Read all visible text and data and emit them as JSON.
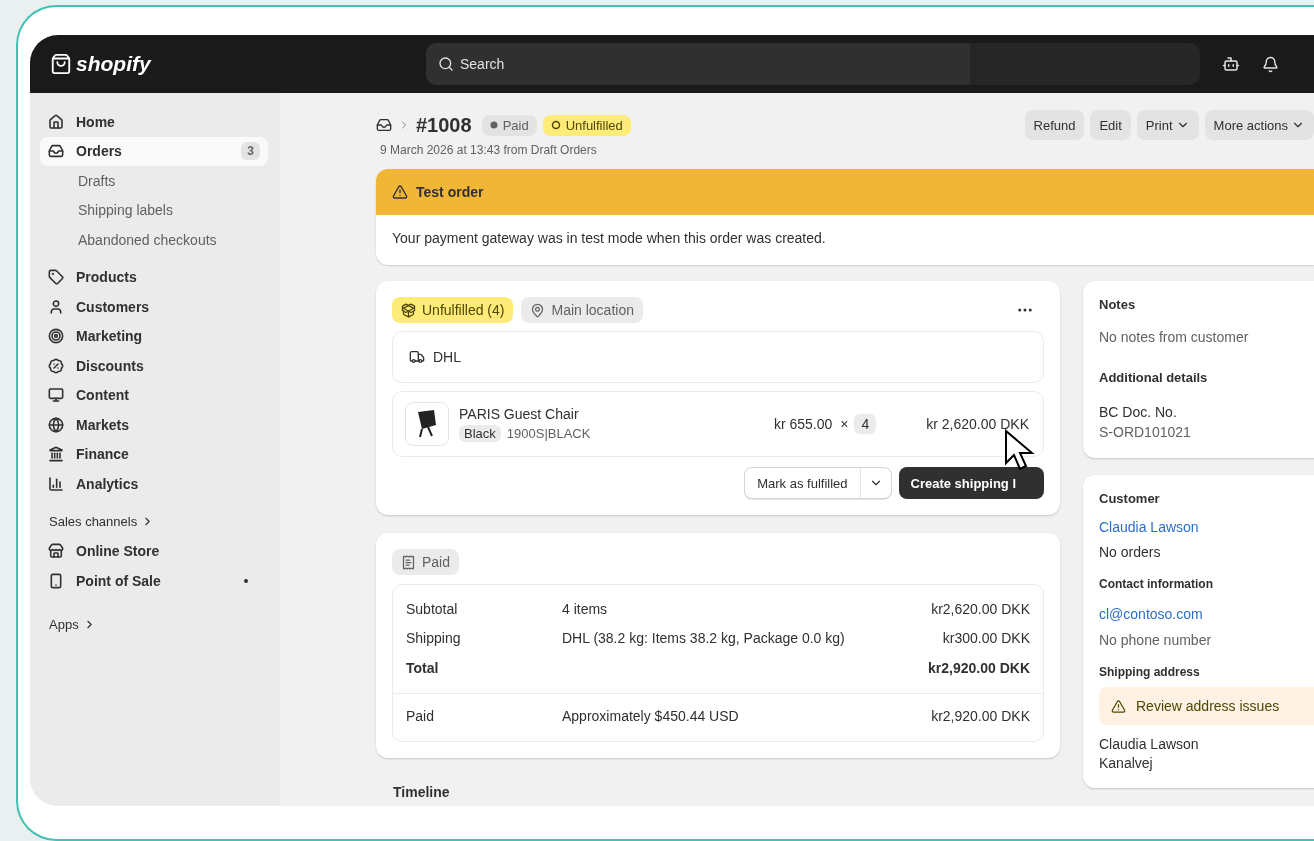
{
  "topbar": {
    "logo": "shopify",
    "search": {
      "placeholder": "Search"
    }
  },
  "sidebar": {
    "items": [
      {
        "kind": "nav",
        "label": "Home",
        "selected": false
      },
      {
        "kind": "nav",
        "label": "Orders",
        "selected": true,
        "badge": "3"
      },
      {
        "kind": "sub",
        "label": "Drafts",
        "selected": false
      },
      {
        "kind": "sub",
        "label": "Shipping labels",
        "selected": false
      },
      {
        "kind": "sub",
        "label": "Abandoned checkouts",
        "selected": false
      },
      {
        "kind": "nav",
        "label": "Products",
        "selected": false
      },
      {
        "kind": "nav",
        "label": "Customers",
        "selected": false
      },
      {
        "kind": "nav",
        "label": "Marketing",
        "selected": false
      },
      {
        "kind": "nav",
        "label": "Discounts",
        "selected": false
      },
      {
        "kind": "nav",
        "label": "Content",
        "selected": false
      },
      {
        "kind": "nav",
        "label": "Markets",
        "selected": false
      },
      {
        "kind": "nav",
        "label": "Finance",
        "selected": false
      },
      {
        "kind": "nav",
        "label": "Analytics",
        "selected": false
      },
      {
        "kind": "section",
        "label": "Sales channels"
      },
      {
        "kind": "nav",
        "label": "Online Store",
        "selected": false
      },
      {
        "kind": "nav",
        "label": "Point of Sale",
        "selected": false,
        "pinned": true
      },
      {
        "kind": "section",
        "label": "Apps"
      }
    ]
  },
  "order": {
    "number": "#1008",
    "badges": [
      {
        "kind": "paid",
        "label": "Paid"
      },
      {
        "kind": "unfulfilled",
        "label": "Unfulfilled"
      }
    ],
    "date": "9 March 2026 at 13:43 from Draft Orders",
    "actions": [
      {
        "label": "Refund",
        "dropdown": false
      },
      {
        "label": "Edit",
        "dropdown": false
      },
      {
        "label": "Print",
        "dropdown": true
      },
      {
        "label": "More actions",
        "dropdown": true
      }
    ]
  },
  "banner": {
    "title": "Test order",
    "text": "Your payment gateway was in test mode when this order was created."
  },
  "fulfillment": {
    "status": "Unfulfilled (4)",
    "location": "Main location",
    "carrier": "DHL",
    "item": {
      "name": "PARIS Guest Chair",
      "variant": "Black",
      "sku": "1900S|BLACK",
      "price": "kr 655.00",
      "times": "×",
      "quantity": "4",
      "total": "kr 2,620.00 DKK"
    },
    "secondary_button": "Mark as fulfilled",
    "primary_button": "Create shipping l"
  },
  "payment": {
    "status": "Paid",
    "rows": [
      {
        "label": "Subtotal",
        "detail": "4 items",
        "amount": "kr2,620.00 DKK",
        "bold": false
      },
      {
        "label": "Shipping",
        "detail": "DHL (38.2 kg: Items 38.2 kg, Package 0.0 kg)",
        "amount": "kr300.00 DKK",
        "bold": false
      },
      {
        "label": "Total",
        "detail": "",
        "amount": "kr2,920.00 DKK",
        "bold": true
      }
    ],
    "paid": {
      "label": "Paid",
      "detail": "Approximately $450.44 USD",
      "amount": "kr2,920.00 DKK"
    }
  },
  "timeline": {
    "title": "Timeline"
  },
  "notes": {
    "title": "Notes",
    "text": "No notes from customer",
    "details_title": "Additional details",
    "details_label": "BC Doc. No.",
    "details_value": "S-ORD101021"
  },
  "customer": {
    "title": "Customer",
    "name": "Claudia Lawson",
    "orders": "No orders",
    "contact_title": "Contact information",
    "email": "cl@contoso.com",
    "phone": "No phone number",
    "shipping_title": "Shipping address",
    "warning": "Review address issues",
    "address": [
      "Claudia Lawson",
      "Kanalvej"
    ]
  }
}
